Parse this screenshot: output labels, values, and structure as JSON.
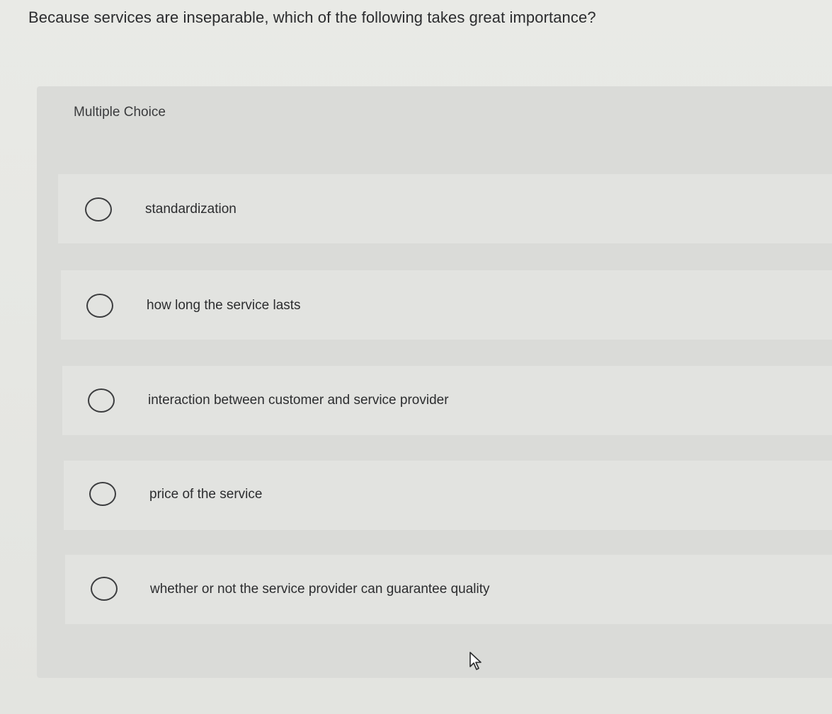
{
  "question": {
    "text": "Because services are inseparable, which of the following takes great importance?"
  },
  "quiz": {
    "type_label": "Multiple Choice",
    "options": [
      {
        "label": "standardization",
        "selected": false
      },
      {
        "label": "how long the service lasts",
        "selected": false
      },
      {
        "label": "interaction between customer and service provider",
        "selected": false
      },
      {
        "label": "price of the service",
        "selected": false
      },
      {
        "label": "whether or not the service provider can guarantee quality",
        "selected": false
      }
    ]
  },
  "icons": {
    "radio": "radio-unchecked-icon",
    "cursor": "mouse-pointer-icon"
  }
}
